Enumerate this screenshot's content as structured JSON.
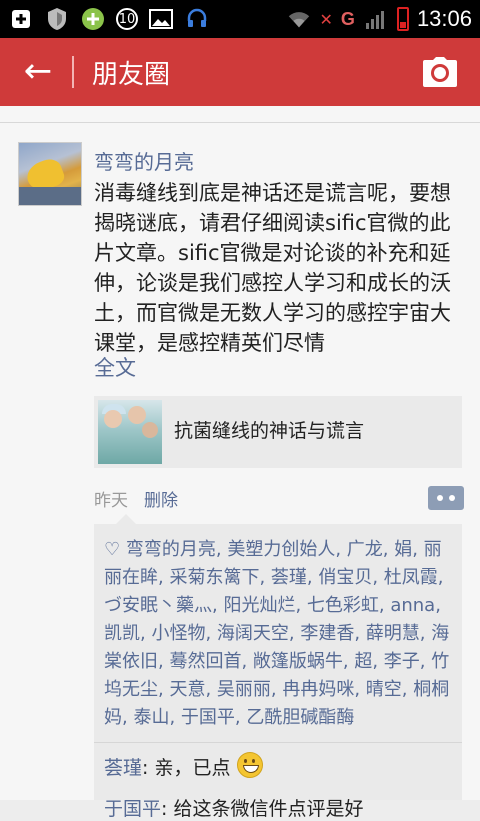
{
  "status_bar": {
    "time": "13:06",
    "notification_count": "10",
    "network_label": "G",
    "icons": [
      "plus-icon",
      "shield-icon",
      "add-app-icon",
      "image-icon",
      "headset-icon",
      "wifi-icon",
      "signal-icon",
      "battery-icon"
    ]
  },
  "header": {
    "title": "朋友圈",
    "back_icon": "arrow-left-icon",
    "camera_icon": "camera-icon",
    "back_glyph": "←"
  },
  "post": {
    "author": "弯弯的月亮",
    "text": "消毒缝线到底是神话还是谎言呢，要想揭晓谜底，请君仔细阅读sific官微的此片文章。sific官微是对论谈的补充和延伸，论谈是我们感控人学习和成长的沃土，而官微是无数人学习的感控宇宙大课堂，是感控精英们尽情",
    "full_text_label": "全文",
    "link_title": "抗菌缝线的神话与谎言",
    "time": "昨天",
    "delete_label": "删除"
  },
  "likes": {
    "heart_glyph": "♡",
    "names": "弯弯的月亮, 美塑力创始人, 广龙, 娟, 丽丽在眸, 采菊东篱下, 荟瑾, 俏宝贝, 杜凤霞, づ安眠丶藥灬, 阳光灿烂, 七色彩虹, anna, 凯凯, 小怪物, 海阔天空, 李建香, 薛明慧, 海棠依旧, 蓦然回首, 敞篷版蜗牛, 超, 李子, 竹坞无尘, 天意, 吴丽丽, 冉冉妈咪, 晴空, 桐桐妈, 泰山, 于国平, 乙酰胆碱酯酶"
  },
  "comments": [
    {
      "author": "荟瑾",
      "text": ": 亲，已点"
    },
    {
      "author": "于国平",
      "text": ": 给这条微信件点评是好"
    }
  ],
  "colors": {
    "title_bar": "#cf3a3a",
    "link_blue": "#576b95"
  }
}
